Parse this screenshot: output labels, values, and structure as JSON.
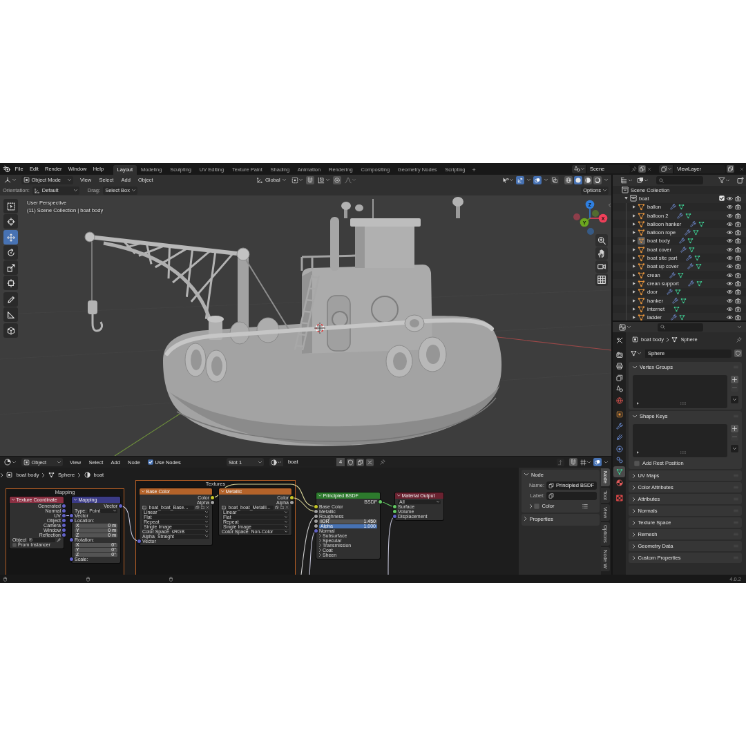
{
  "topbar": {
    "menus": [
      "File",
      "Edit",
      "Render",
      "Window",
      "Help"
    ],
    "workspaces": [
      {
        "label": "Layout",
        "selected": true
      },
      {
        "label": "Modeling",
        "selected": false
      },
      {
        "label": "Sculpting",
        "selected": false
      },
      {
        "label": "UV Editing",
        "selected": false
      },
      {
        "label": "Texture Paint",
        "selected": false
      },
      {
        "label": "Shading",
        "selected": false
      },
      {
        "label": "Animation",
        "selected": false
      },
      {
        "label": "Rendering",
        "selected": false
      },
      {
        "label": "Compositing",
        "selected": false
      },
      {
        "label": "Geometry Nodes",
        "selected": false
      },
      {
        "label": "Scripting",
        "selected": false
      }
    ],
    "add_workspace": "+",
    "scene": "Scene",
    "view_layer": "ViewLayer"
  },
  "viewport": {
    "mode": "Object Mode",
    "menus": [
      "View",
      "Select",
      "Add",
      "Object"
    ],
    "orientation": "Global",
    "toggles": [
      {
        "kind": "snap",
        "on": false
      },
      {
        "kind": "proportional",
        "on": false
      }
    ],
    "view_toggles": [
      {
        "kind": "gizmos",
        "on": true
      },
      {
        "kind": "overlays",
        "on": true
      },
      {
        "kind": "xray",
        "on": false
      }
    ],
    "shading": [
      {
        "kind": "wireframe",
        "selected": false
      },
      {
        "kind": "solid",
        "selected": true
      },
      {
        "kind": "material",
        "selected": false
      },
      {
        "kind": "rendered",
        "selected": false
      }
    ],
    "tool_settings": {
      "orientation_label": "Orientation:",
      "orientation": "Default",
      "drag_label": "Drag:",
      "drag": "Select Box",
      "options": "Options"
    },
    "tools": [
      {
        "kind": "select",
        "selected": false
      },
      {
        "kind": "cursor",
        "selected": false
      },
      {
        "kind": "move",
        "selected": true
      },
      {
        "kind": "rotate",
        "selected": false
      },
      {
        "kind": "scale",
        "selected": false
      },
      {
        "kind": "transform",
        "selected": false
      },
      {
        "kind": "annotate",
        "selected": false
      },
      {
        "kind": "measure",
        "selected": false
      },
      {
        "kind": "add_cube",
        "selected": false
      }
    ],
    "info": [
      "User Perspective",
      "(11) Scene Collection | boat body"
    ],
    "axes": [
      {
        "label": "Z",
        "color": "#2f7fe0"
      },
      {
        "label": "Y",
        "color": "#6ba61f"
      },
      {
        "label": "X",
        "color": "#f0405a"
      }
    ]
  },
  "node_editor": {
    "mode": "Object",
    "menus": [
      "View",
      "Select",
      "Add",
      "Node"
    ],
    "use_nodes": {
      "label": "Use Nodes",
      "checked": true
    },
    "slot": "Slot 1",
    "material": "boat",
    "users": "4",
    "view_toggles": [
      {
        "kind": "snap",
        "on": false
      },
      {
        "kind": "overlays",
        "on": true
      }
    ],
    "breadcrumb": [
      "boat body",
      "Sphere",
      "boat"
    ],
    "frames": [
      {
        "title": "Mapping"
      },
      {
        "title": "Textures"
      }
    ],
    "nodes": [
      {
        "title": "Texture Coordinate",
        "color": "#8a3042",
        "rows": [
          {
            "kind": "output",
            "label": "Generated",
            "color": "#6363c7"
          },
          {
            "kind": "output",
            "label": "Normal",
            "color": "#6363c7"
          },
          {
            "kind": "output",
            "label": "UV",
            "color": "#6363c7"
          },
          {
            "kind": "output",
            "label": "Object",
            "color": "#6363c7"
          },
          {
            "kind": "output",
            "label": "Camera",
            "color": "#6363c7"
          },
          {
            "kind": "output",
            "label": "Window",
            "color": "#6363c7"
          },
          {
            "kind": "output",
            "label": "Reflection",
            "color": "#6363c7"
          },
          {
            "kind": "object",
            "label": "Object"
          },
          {
            "kind": "check",
            "label": "From Instancer",
            "checked": false
          }
        ]
      },
      {
        "title": "Mapping",
        "color": "#3b3b86",
        "rows": [
          {
            "kind": "output",
            "label": "Vector",
            "color": "#6363c7"
          },
          {
            "kind": "dropdown",
            "label": "Type:",
            "value": "Point"
          },
          {
            "kind": "input",
            "label": "Vector",
            "color": "#6363c7"
          },
          {
            "kind": "input",
            "label": "Location:",
            "color": "#6363c7"
          },
          {
            "kind": "field",
            "label": "X",
            "value": "0 m"
          },
          {
            "kind": "field",
            "label": "Y",
            "value": "0 m"
          },
          {
            "kind": "field",
            "label": "Z",
            "value": "0 m"
          },
          {
            "kind": "input",
            "label": "Rotation:",
            "color": "#6363c7"
          },
          {
            "kind": "field",
            "label": "X",
            "value": "0°"
          },
          {
            "kind": "field",
            "label": "Y",
            "value": "0°"
          },
          {
            "kind": "field",
            "label": "Z",
            "value": "0°"
          },
          {
            "kind": "input",
            "label": "Scale:",
            "color": "#6363c7"
          }
        ]
      },
      {
        "title": "Base Color",
        "color": "#b4632a",
        "rows": [
          {
            "kind": "output",
            "label": "Color",
            "color": "#c7c729"
          },
          {
            "kind": "output",
            "label": "Alpha",
            "color": "#a1a1a1"
          },
          {
            "kind": "image",
            "value": "boat_boat_Base..."
          },
          {
            "kind": "dropdown",
            "value": "Linear"
          },
          {
            "kind": "dropdown",
            "value": "Flat"
          },
          {
            "kind": "dropdown",
            "value": "Repeat"
          },
          {
            "kind": "dropdown",
            "value": "Single Image"
          },
          {
            "kind": "dropdown",
            "label": "Color Space",
            "value": "sRGB"
          },
          {
            "kind": "dropdown",
            "label": "Alpha",
            "value": "Straight"
          },
          {
            "kind": "input",
            "label": "Vector",
            "color": "#6363c7"
          }
        ]
      },
      {
        "title": "Metallic",
        "color": "#b4632a",
        "rows": [
          {
            "kind": "output",
            "label": "Color",
            "color": "#c7c729"
          },
          {
            "kind": "output",
            "label": "Alpha",
            "color": "#a1a1a1"
          },
          {
            "kind": "image",
            "value": "boat_boat_Metalli..."
          },
          {
            "kind": "dropdown",
            "value": "Linear"
          },
          {
            "kind": "dropdown",
            "value": "Flat"
          },
          {
            "kind": "dropdown",
            "value": "Repeat"
          },
          {
            "kind": "dropdown",
            "value": "Single Image"
          },
          {
            "kind": "dropdown",
            "label": "Color Space",
            "value": "Non-Color"
          }
        ]
      },
      {
        "title": "Principled BSDF",
        "color": "#2d7a2d",
        "rows": [
          {
            "kind": "output",
            "label": "BSDF",
            "color": "#63c763"
          },
          {
            "kind": "input",
            "label": "Base Color",
            "color": "#c7c729"
          },
          {
            "kind": "input",
            "label": "Metallic",
            "color": "#a1a1a1"
          },
          {
            "kind": "input",
            "label": "Roughness",
            "color": "#a1a1a1"
          },
          {
            "kind": "field",
            "label": "IOR",
            "value": "1.450",
            "color": "#a1a1a1"
          },
          {
            "kind": "slider",
            "label": "Alpha",
            "value": "1.000",
            "level": 1,
            "color": "#a1a1a1"
          },
          {
            "kind": "input",
            "label": "Normal",
            "color": "#6363c7"
          },
          {
            "kind": "panel",
            "label": "Subsurface"
          },
          {
            "kind": "panel",
            "label": "Specular"
          },
          {
            "kind": "panel",
            "label": "Transmission"
          },
          {
            "kind": "panel",
            "label": "Coat"
          },
          {
            "kind": "panel",
            "label": "Sheen"
          }
        ]
      },
      {
        "title": "Material Output",
        "color": "#6a2230",
        "rows": [
          {
            "kind": "dropdown",
            "value": "All"
          },
          {
            "kind": "input",
            "label": "Surface",
            "color": "#63c763"
          },
          {
            "kind": "input",
            "label": "Volume",
            "color": "#63c763"
          },
          {
            "kind": "input",
            "label": "Displacement",
            "color": "#6363c7"
          }
        ]
      }
    ],
    "sidebar": {
      "panel": {
        "title": "Node",
        "expanded": true
      },
      "name": {
        "label": "Name:",
        "value": "Principled BSDF"
      },
      "label": {
        "label": "Label:"
      },
      "color": {
        "label": "Color",
        "checked": false,
        "expanded": false
      },
      "properties": {
        "title": "Properties",
        "expanded": false
      },
      "tabs": [
        {
          "label": "Node",
          "selected": true
        },
        {
          "label": "Tool",
          "selected": false
        },
        {
          "label": "View",
          "selected": false
        },
        {
          "label": "Options",
          "selected": false
        },
        {
          "label": "Node W",
          "selected": false
        }
      ]
    }
  },
  "outliner": {
    "scene_collection": "Scene Collection",
    "collection": {
      "name": "boat",
      "checked": true,
      "expanded": true
    },
    "objects": [
      {
        "name": "ballon",
        "modifier": true,
        "active": false,
        "expanded": false
      },
      {
        "name": "balloon 2",
        "modifier": true,
        "active": false,
        "expanded": false
      },
      {
        "name": "balloon hanker",
        "modifier": true,
        "active": false,
        "expanded": false
      },
      {
        "name": "balloon rope",
        "modifier": true,
        "active": false,
        "expanded": false
      },
      {
        "name": "boat body",
        "modifier": true,
        "active": true,
        "expanded": false
      },
      {
        "name": "boat cover",
        "modifier": true,
        "active": false,
        "expanded": false
      },
      {
        "name": "boat site part",
        "modifier": true,
        "active": false,
        "expanded": false
      },
      {
        "name": "boat up cover",
        "modifier": true,
        "active": false,
        "expanded": false
      },
      {
        "name": "crean",
        "modifier": true,
        "active": false,
        "expanded": false
      },
      {
        "name": "crean support",
        "modifier": true,
        "active": false,
        "expanded": false
      },
      {
        "name": "door",
        "modifier": true,
        "active": false,
        "expanded": false
      },
      {
        "name": "hanker",
        "modifier": true,
        "active": false,
        "expanded": false
      },
      {
        "name": "internet",
        "modifier": false,
        "active": false,
        "expanded": false
      },
      {
        "name": "ladder",
        "modifier": true,
        "active": false,
        "expanded": false
      }
    ]
  },
  "properties": {
    "tabs": [
      {
        "kind": "tool",
        "selected": false
      },
      {
        "kind": "render",
        "selected": false
      },
      {
        "kind": "output",
        "selected": false
      },
      {
        "kind": "view_layer",
        "selected": false
      },
      {
        "kind": "scene",
        "selected": false
      },
      {
        "kind": "world",
        "selected": false
      },
      {
        "kind": "object",
        "selected": false
      },
      {
        "kind": "modifiers",
        "selected": false
      },
      {
        "kind": "particles",
        "selected": false
      },
      {
        "kind": "physics",
        "selected": false
      },
      {
        "kind": "constraints",
        "selected": false
      },
      {
        "kind": "data",
        "selected": true
      },
      {
        "kind": "material",
        "selected": false
      },
      {
        "kind": "texture",
        "selected": false
      }
    ],
    "breadcrumb": [
      "boat body",
      "Sphere"
    ],
    "datablock": "Sphere",
    "panels": [
      {
        "title": "Vertex Groups",
        "expanded": true
      },
      {
        "title": "Shape Keys",
        "expanded": true,
        "option": {
          "label": "Add Rest Position",
          "checked": false
        }
      },
      {
        "title": "UV Maps",
        "expanded": false
      },
      {
        "title": "Color Attributes",
        "expanded": false
      },
      {
        "title": "Attributes",
        "expanded": false
      },
      {
        "title": "Normals",
        "expanded": false
      },
      {
        "title": "Texture Space",
        "expanded": false
      },
      {
        "title": "Remesh",
        "expanded": false
      },
      {
        "title": "Geometry Data",
        "expanded": false
      },
      {
        "title": "Custom Properties",
        "expanded": false
      }
    ]
  },
  "status_bar": {
    "version": "4.0.2"
  }
}
